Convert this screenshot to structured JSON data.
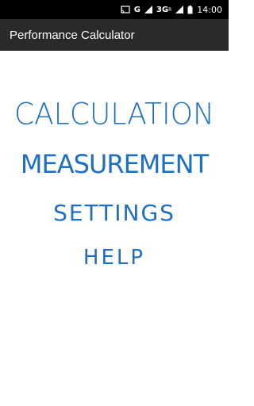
{
  "status_bar": {
    "network_label": "G",
    "network_type": "3G",
    "network_sup": "R",
    "time": "14:00",
    "icons": [
      "cast-icon",
      "signal-icon",
      "battery-icon"
    ]
  },
  "action_bar": {
    "title": "Performance Calculator"
  },
  "menu": {
    "items": [
      {
        "label": "CALCULATION"
      },
      {
        "label": "MEASUREMENT"
      },
      {
        "label": "SETTINGS"
      },
      {
        "label": "HELP"
      }
    ],
    "color": "#1e6fc0"
  }
}
